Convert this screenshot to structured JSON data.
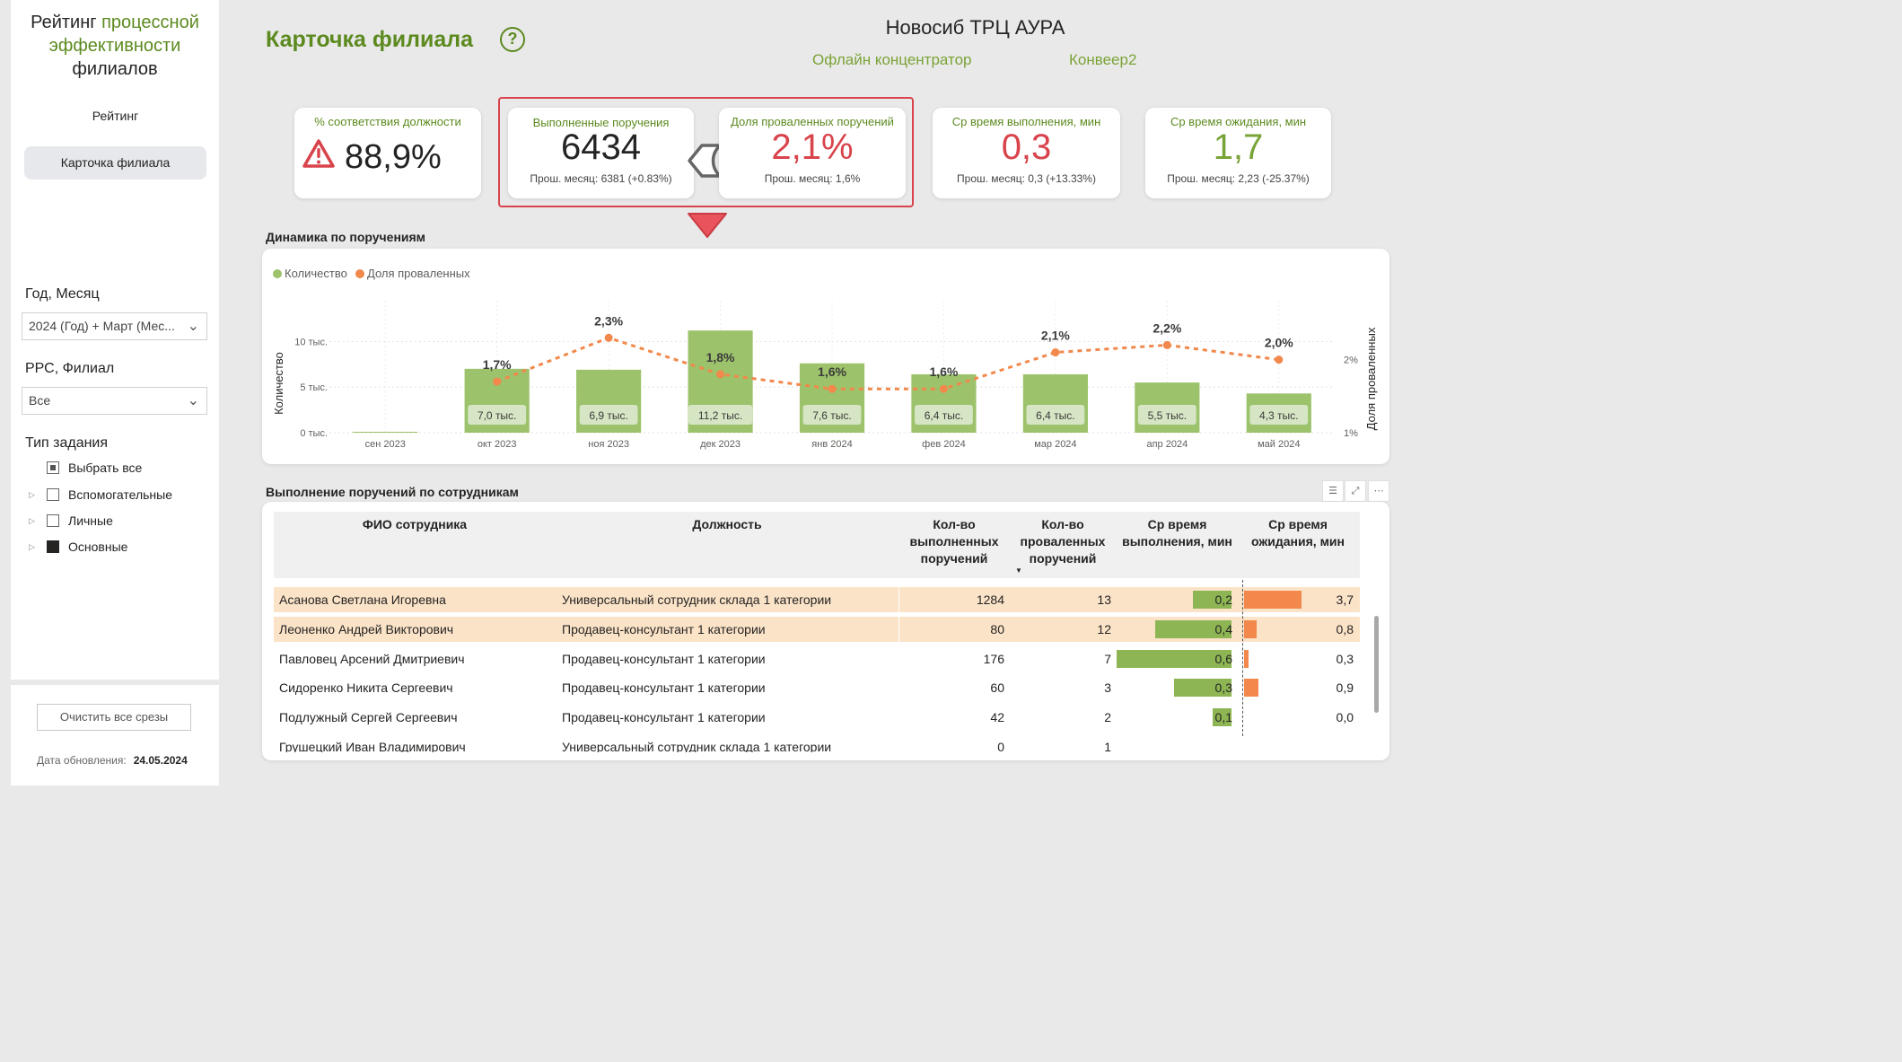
{
  "sidebar": {
    "title_part1": "Рейтинг ",
    "title_part2": "процессной эффективности",
    "title_part3": "филиалов",
    "nav": [
      {
        "label": "Рейтинг"
      },
      {
        "label": "Карточка филиала"
      }
    ],
    "filters": {
      "period_label": "Год, Месяц",
      "period_value": "2024 (Год) + Март (Мес...",
      "branch_label": "РРС, Филиал",
      "branch_value": "Все",
      "task_type_label": "Тип задания",
      "task_types": [
        {
          "label": "Выбрать все",
          "state": "partial"
        },
        {
          "label": "Вспомогательные",
          "state": "off"
        },
        {
          "label": "Личные",
          "state": "off"
        },
        {
          "label": "Основные",
          "state": "on"
        }
      ]
    },
    "clear_button": "Очистить все срезы",
    "update_label": "Дата обновления:",
    "update_date": "24.05.2024"
  },
  "header": {
    "page_title": "Карточка филиала",
    "help": "?",
    "branch_name": "Новосиб ТРЦ АУРА",
    "format": "Офлайн концентратор",
    "conveyor": "Конвеер2"
  },
  "kpis": [
    {
      "title": "% соответствия должности",
      "value": "88,9%",
      "prev": "",
      "value_color": "#252423",
      "icon": "warning-icon"
    },
    {
      "title": "Выполненные поручения",
      "value": "6434",
      "prev": "Прош. месяц: 6381 (+0.83%)",
      "value_color": "#252423"
    },
    {
      "title": "Доля проваленных поручений",
      "value": "2,1%",
      "prev": "Прош. месяц: 1,6%",
      "value_color": "#d9434b"
    },
    {
      "title": "Ср время выполнения, мин",
      "value": "0,3",
      "prev": "Прош. месяц: 0,3 (+13.33%)",
      "value_color": "#d9434b"
    },
    {
      "title": "Ср время ожидания, мин",
      "value": "1,7",
      "prev": "Прош. месяц: 2,23 (-25.37%)",
      "value_color": "#7aa336"
    }
  ],
  "chart_section_title": "Динамика по поручениям",
  "chart_data": {
    "type": "bar",
    "categories": [
      "сен 2023",
      "окт 2023",
      "ноя 2023",
      "дек 2023",
      "янв 2024",
      "фев 2024",
      "мар 2024",
      "апр 2024",
      "май 2024"
    ],
    "series": [
      {
        "name": "Количество",
        "type": "bar",
        "color": "#9cc36b",
        "values": [
          0.1,
          7.0,
          6.9,
          11.2,
          7.6,
          6.4,
          6.4,
          5.5,
          4.3
        ],
        "labels": [
          "",
          "7,0 тыс.",
          "6,9 тыс.",
          "11,2 тыс.",
          "7,6 тыс.",
          "6,4 тыс.",
          "6,4 тыс.",
          "5,5 тыс.",
          "4,3 тыс."
        ]
      },
      {
        "name": "Доля проваленных",
        "type": "line",
        "color": "#f2884b",
        "values": [
          null,
          1.7,
          2.3,
          1.8,
          1.6,
          1.6,
          2.1,
          2.2,
          2.0
        ],
        "labels": [
          "",
          "1,7%",
          "2,3%",
          "1,8%",
          "1,6%",
          "1,6%",
          "2,1%",
          "2,2%",
          "2,0%"
        ]
      }
    ],
    "ylabel": "Количество",
    "y2label": "Доля проваленных",
    "y_ticks": [
      "0 тыс.",
      "5 тыс.",
      "10 тыс."
    ],
    "y2_ticks": [
      "1%",
      "2%"
    ],
    "ylim": [
      0,
      12
    ],
    "y2lim": [
      1,
      2.5
    ],
    "legend_position": "top-left"
  },
  "table": {
    "title": "Выполнение поручений по сотрудникам",
    "columns": [
      "ФИО сотрудника",
      "Должность",
      "Кол-во выполненных поручений",
      "Кол-во проваленных поручений",
      "Ср время выполнения, мин",
      "Ср время ожидания, мин"
    ],
    "rows": [
      {
        "name": "Асанова Светлана Игоревна",
        "position": "Универсальный сотрудник склада 1 категории",
        "done": "1284",
        "failed": "13",
        "exec": "0,2",
        "wait": "3,7",
        "exec_v": 0.2,
        "wait_v": 3.7,
        "highlight": true
      },
      {
        "name": "Леоненко Андрей Викторович",
        "position": "Продавец-консультант 1 категории",
        "done": "80",
        "failed": "12",
        "exec": "0,4",
        "wait": "0,8",
        "exec_v": 0.4,
        "wait_v": 0.8,
        "highlight": true
      },
      {
        "name": "Павловец Арсений Дмитриевич",
        "position": "Продавец-консультант 1 категории",
        "done": "176",
        "failed": "7",
        "exec": "0,6",
        "wait": "0,3",
        "exec_v": 0.6,
        "wait_v": 0.3,
        "highlight": false
      },
      {
        "name": "Сидоренко Никита Сергеевич",
        "position": "Продавец-консультант 1 категории",
        "done": "60",
        "failed": "3",
        "exec": "0,3",
        "wait": "0,9",
        "exec_v": 0.3,
        "wait_v": 0.9,
        "highlight": false
      },
      {
        "name": "Подлужный Сергей Сергеевич",
        "position": "Продавец-консультант 1 категории",
        "done": "42",
        "failed": "2",
        "exec": "0,1",
        "wait": "0,0",
        "exec_v": 0.1,
        "wait_v": 0.0,
        "highlight": false
      },
      {
        "name": "Грушецкий Иван Владимирович",
        "position": "Универсальный сотрудник склада 1 категории",
        "done": "0",
        "failed": "1",
        "exec": "",
        "wait": "",
        "exec_v": 0,
        "wait_v": 0,
        "highlight": false
      }
    ]
  },
  "colors": {
    "accent": "#5c8a1f",
    "bar": "#9cc36b",
    "line": "#f2884b",
    "alert": "#d9434b",
    "row_highlight": "#fbe3c8"
  }
}
